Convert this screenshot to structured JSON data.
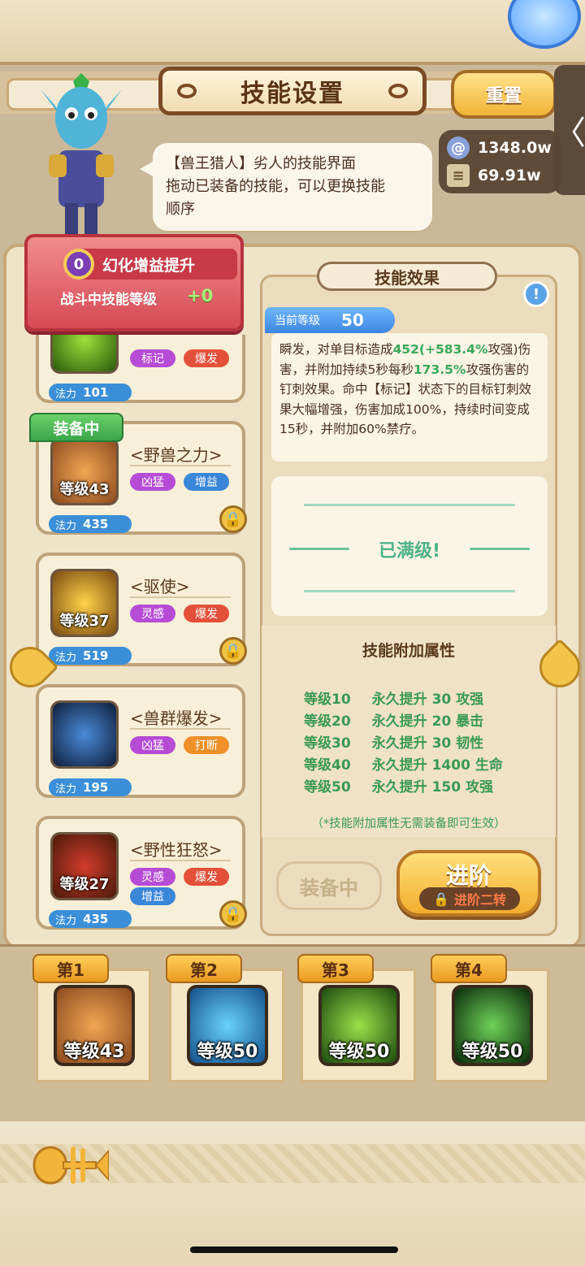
{
  "title": "技能设置",
  "reset_label": "重置",
  "side_tab_glyph": "〈",
  "currency": [
    {
      "icon": "swirl-coin-icon",
      "value": "1348.0w",
      "color": "#8aa0d8"
    },
    {
      "icon": "scroll-icon",
      "value": "69.91w",
      "color": "#d9c7a1"
    }
  ],
  "speech": {
    "line1": "【兽王猎人】劣人的技能界面",
    "line2": "拖动已装备的技能，可以更换技能",
    "line3": "顺序"
  },
  "buff": {
    "badge": "0",
    "title": "幻化增益提升",
    "subtitle": "战斗中技能等级",
    "plus": "+0"
  },
  "equip_flag": "装备中",
  "partial_card": {
    "tag1": "标记",
    "tag2": "爆发",
    "mana_label": "法力",
    "mana": "101"
  },
  "skills": [
    {
      "name": "<野兽之力>",
      "tags": [
        "凶猛",
        "增益"
      ],
      "level": "等级43",
      "mana_label": "法力",
      "mana": "435",
      "locked": true
    },
    {
      "name": "<驱使>",
      "tags": [
        "灵感",
        "爆发"
      ],
      "level": "等级37",
      "mana_label": "法力",
      "mana": "519",
      "locked": true
    },
    {
      "name": "<兽群爆发>",
      "tags": [
        "凶猛",
        "打断"
      ],
      "level": "",
      "mana_label": "法力",
      "mana": "195",
      "locked": false
    },
    {
      "name": "<野性狂怒>",
      "tags": [
        "灵感",
        "爆发",
        "增益"
      ],
      "level": "等级27",
      "mana_label": "法力",
      "mana": "435",
      "locked": true
    }
  ],
  "tag_colors": {
    "凶猛": "#b64cd6",
    "灵感": "#b64cd6",
    "增益": "#3a86d8",
    "爆发": "#e2503a",
    "打断": "#f0902a",
    "标记": "#b64cd6"
  },
  "effect": {
    "header": "技能效果",
    "info_glyph": "!",
    "current_level_label": "当前等级",
    "current_level": "50",
    "desc_a": "瞬发，对单目标造成",
    "desc_b": "452",
    "desc_c": "(+583.4%",
    "desc_d": "攻强)",
    "desc_e": "伤害，并附加持续5秒每秒",
    "desc_f": "173.5%",
    "desc_g": "攻强",
    "desc_h": "伤害的钉刺效果。命中【标记】状态下的目标钉刺效果大幅增强，伤害加成100%，持续时间变成15秒，并附加60%禁疗。",
    "max_level": "已满级!",
    "attr_title": "技能附加属性",
    "attrs": [
      {
        "lv": "等级10",
        "text": "永久提升 30 攻强"
      },
      {
        "lv": "等级20",
        "text": "永久提升 20 暴击"
      },
      {
        "lv": "等级30",
        "text": "永久提升 30 韧性"
      },
      {
        "lv": "等级40",
        "text": "永久提升 1400 生命"
      },
      {
        "lv": "等级50",
        "text": "永久提升 150 攻强"
      }
    ],
    "note": "（*技能附加属性无需装备即可生效）",
    "equipped_label": "装备中",
    "advance_label": "进阶",
    "advance_sub": "进阶二转"
  },
  "slots": [
    {
      "label": "第1",
      "level": "等级43"
    },
    {
      "label": "第2",
      "level": "等级50"
    },
    {
      "label": "第3",
      "level": "等级50"
    },
    {
      "label": "第4",
      "level": "等级50"
    }
  ]
}
